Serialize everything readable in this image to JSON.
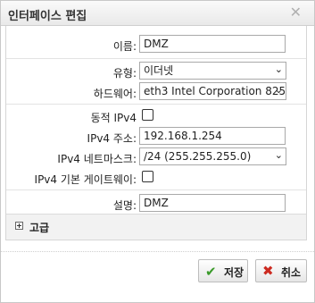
{
  "dialog": {
    "title": "인터페이스 편집",
    "close_glyph": "✕"
  },
  "form": {
    "name_label": "이름:",
    "name_value": "DMZ",
    "type_label": "유형:",
    "type_value": "이더넷",
    "hardware_label": "하드웨어:",
    "hardware_value": "eth3 Intel Corporation 825",
    "dynamic_ipv4_label": "동적 IPv4",
    "dynamic_ipv4_checked": false,
    "ipv4_address_label": "IPv4 주소:",
    "ipv4_address_value": "192.168.1.254",
    "ipv4_netmask_label": "IPv4 네트마스크:",
    "ipv4_netmask_value": "/24 (255.255.255.0)",
    "ipv4_default_gateway_label": "IPv4 기본 게이트웨이:",
    "ipv4_default_gateway_checked": false,
    "description_label": "설명:",
    "description_value": "DMZ"
  },
  "advanced": {
    "label": "고급"
  },
  "buttons": {
    "save_label": "저장",
    "cancel_label": "취소"
  },
  "colors": {
    "save_icon": "#3a9a2a",
    "cancel_icon": "#cc2a20"
  }
}
